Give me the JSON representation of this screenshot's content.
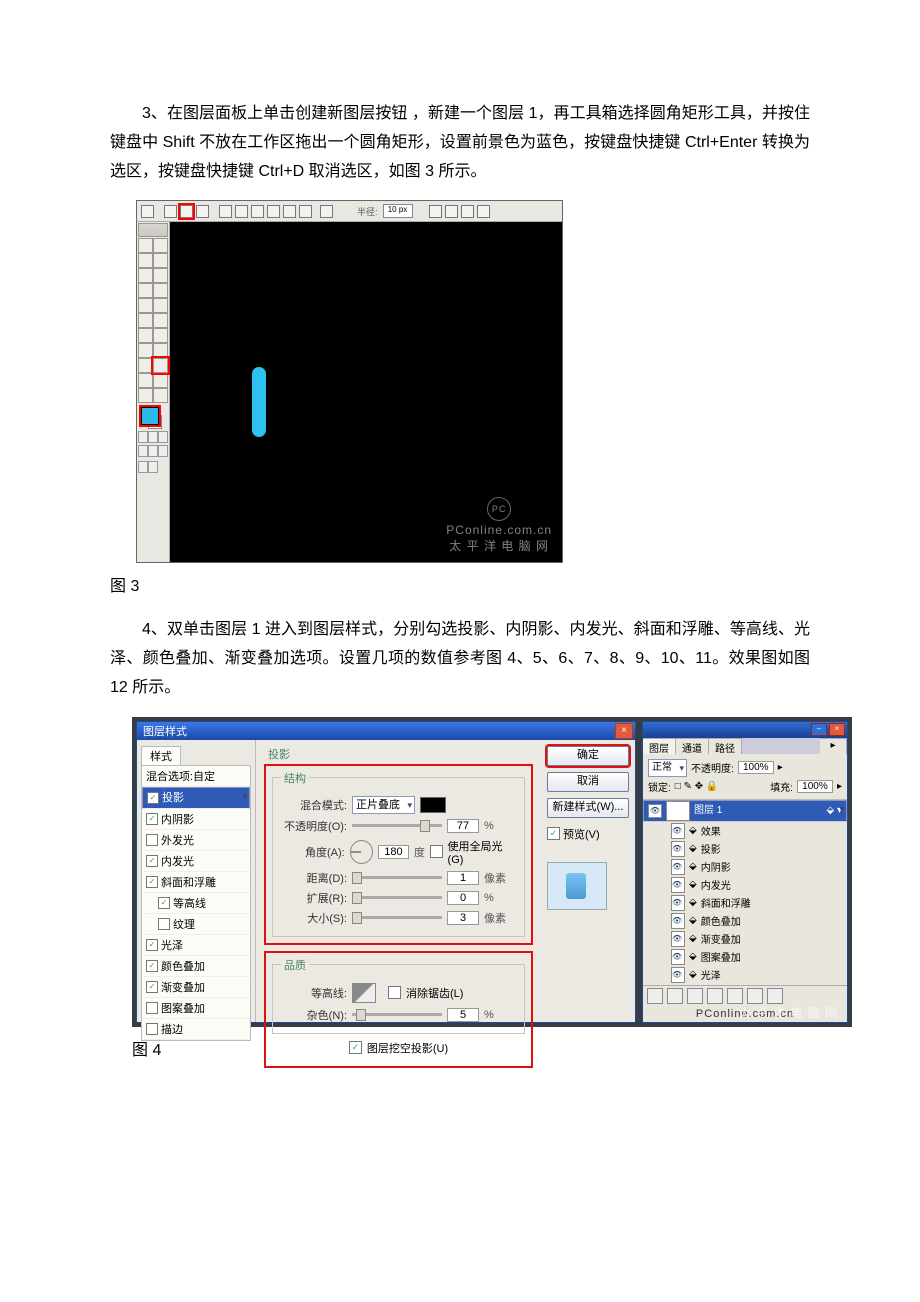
{
  "text": {
    "p3": "3、在图层面板上单击创建新图层按钮 ，新建一个图层 1，再工具箱选择圆角矩形工具，并按住键盘中 Shift 不放在工作区拖出一个圆角矩形，设置前景色为蓝色，按键盘快捷键 Ctrl+Enter 转换为选区，按键盘快捷键 Ctrl+D 取消选区，如图 3 所示。",
    "cap3": "图 3",
    "p4": "4、双单击图层 1 进入到图层样式，分别勾选投影、内阴影、内发光、斜面和浮雕、等高线、光泽、颜色叠加、渐变叠加选项。设置几项的数值参考图 4、5、6、7、8、9、10、11。效果图如图 12 所示。",
    "cap4": "图 4"
  },
  "fig3": {
    "optbar": {
      "radius_label": "半径:",
      "radius_value": "10 px"
    },
    "watermark": {
      "logo": "PC",
      "line1": "PConline.com.cn",
      "line2": "太 平 洋 电 脑 网"
    }
  },
  "fig4": {
    "dialog_title": "图层样式",
    "close_x": "×",
    "styles_header": "样式",
    "styles": {
      "blendopt": "混合选项:自定",
      "dropshadow": "投影",
      "innershadow": "内阴影",
      "outerglow": "外发光",
      "innerglow": "内发光",
      "bevel": "斜面和浮雕",
      "contour": "等高线",
      "texture": "纹理",
      "satin": "光泽",
      "coloroverlay": "颜色叠加",
      "gradientoverlay": "渐变叠加",
      "patternoverlay": "图案叠加",
      "stroke": "描边"
    },
    "section_title": "投影",
    "structure_legend": "结构",
    "labels": {
      "blendmode": "混合模式:",
      "blendmode_val": "正片叠底",
      "opacity": "不透明度(O):",
      "opacity_val": "77",
      "opacity_unit": "%",
      "angle": "角度(A):",
      "angle_val": "180",
      "angle_unit": "度",
      "global": "使用全局光(G)",
      "distance": "距离(D):",
      "distance_val": "1",
      "distance_unit": "像素",
      "spread": "扩展(R):",
      "spread_val": "0",
      "spread_unit": "%",
      "size": "大小(S):",
      "size_val": "3",
      "size_unit": "像素"
    },
    "quality_legend": "品质",
    "quality": {
      "contour": "等高线:",
      "antialias": "消除锯齿(L)",
      "noise": "杂色(N):",
      "noise_val": "5",
      "noise_unit": "%",
      "knockout": "图层挖空投影(U)"
    },
    "buttons": {
      "ok": "确定",
      "cancel": "取消",
      "newstyle": "新建样式(W)...",
      "preview": "预览(V)"
    },
    "layerspanel": {
      "tabs": {
        "layers": "图层",
        "channels": "通道",
        "paths": "路径"
      },
      "mode": "正常",
      "opacity_label": "不透明度:",
      "opacity_val": "100%",
      "lock_label": "锁定:",
      "fill_label": "填充:",
      "fill_val": "100%",
      "layer1": "图层 1",
      "effects_label": "效果",
      "effects": [
        "投影",
        "内阴影",
        "内发光",
        "斜面和浮雕",
        "颜色叠加",
        "渐变叠加",
        "图案叠加",
        "光泽"
      ],
      "wm1": "PConline.com.cn",
      "wm2": "太 平 洋 电 脑 网"
    }
  }
}
